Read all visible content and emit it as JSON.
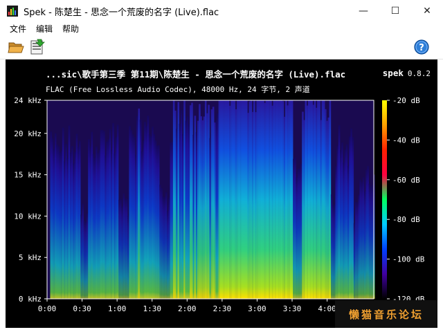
{
  "window": {
    "title": "Spek - 陈楚生 - 思念一个荒废的名字 (Live).flac",
    "controls": {
      "minimize": "—",
      "maximize": "☐",
      "close": "✕"
    }
  },
  "menu": {
    "items": [
      "文件",
      "编辑",
      "帮助"
    ]
  },
  "toolbar": {
    "icons": [
      "open-folder-icon",
      "save-icon",
      "help-icon"
    ],
    "help_glyph": "?"
  },
  "spectrogram": {
    "title": "...sic\\歌手第三季 第11期\\陈楚生 - 思念一个荒废的名字 (Live).flac",
    "app_name": "spek",
    "version": "0.8.2",
    "info": "FLAC (Free Lossless Audio Codec), 48000 Hz, 24 字节, 2 声道"
  },
  "chart_data": {
    "type": "heatmap",
    "x_ticks": [
      "0:00",
      "0:30",
      "1:00",
      "1:30",
      "2:00",
      "2:30",
      "3:00",
      "3:30",
      "4:00"
    ],
    "x_tick_seconds": [
      0,
      30,
      60,
      90,
      120,
      150,
      180,
      210,
      240
    ],
    "x_range_seconds": [
      0,
      280
    ],
    "y_ticks": [
      "0 kHz",
      "5 kHz",
      "10 kHz",
      "15 kHz",
      "20 kHz",
      "24 kHz"
    ],
    "y_tick_khz": [
      0,
      5,
      10,
      15,
      20,
      24
    ],
    "y_range_khz": [
      0,
      24
    ],
    "colorbar_ticks": [
      "-20 dB",
      "-40 dB",
      "-60 dB",
      "-80 dB",
      "-100 dB",
      "-120 dB"
    ],
    "colorbar_db": [
      -20,
      -40,
      -60,
      -80,
      -100,
      -120
    ],
    "colorbar_range_db": [
      -120,
      -20
    ],
    "colorbar_colors": [
      "#ffff00",
      "#ffa000",
      "#ff2000",
      "#ff0040",
      "#00ff60",
      "#00ccff",
      "#0040ff",
      "#4000a0",
      "#000000"
    ]
  },
  "watermark": "懒猫音乐论坛"
}
